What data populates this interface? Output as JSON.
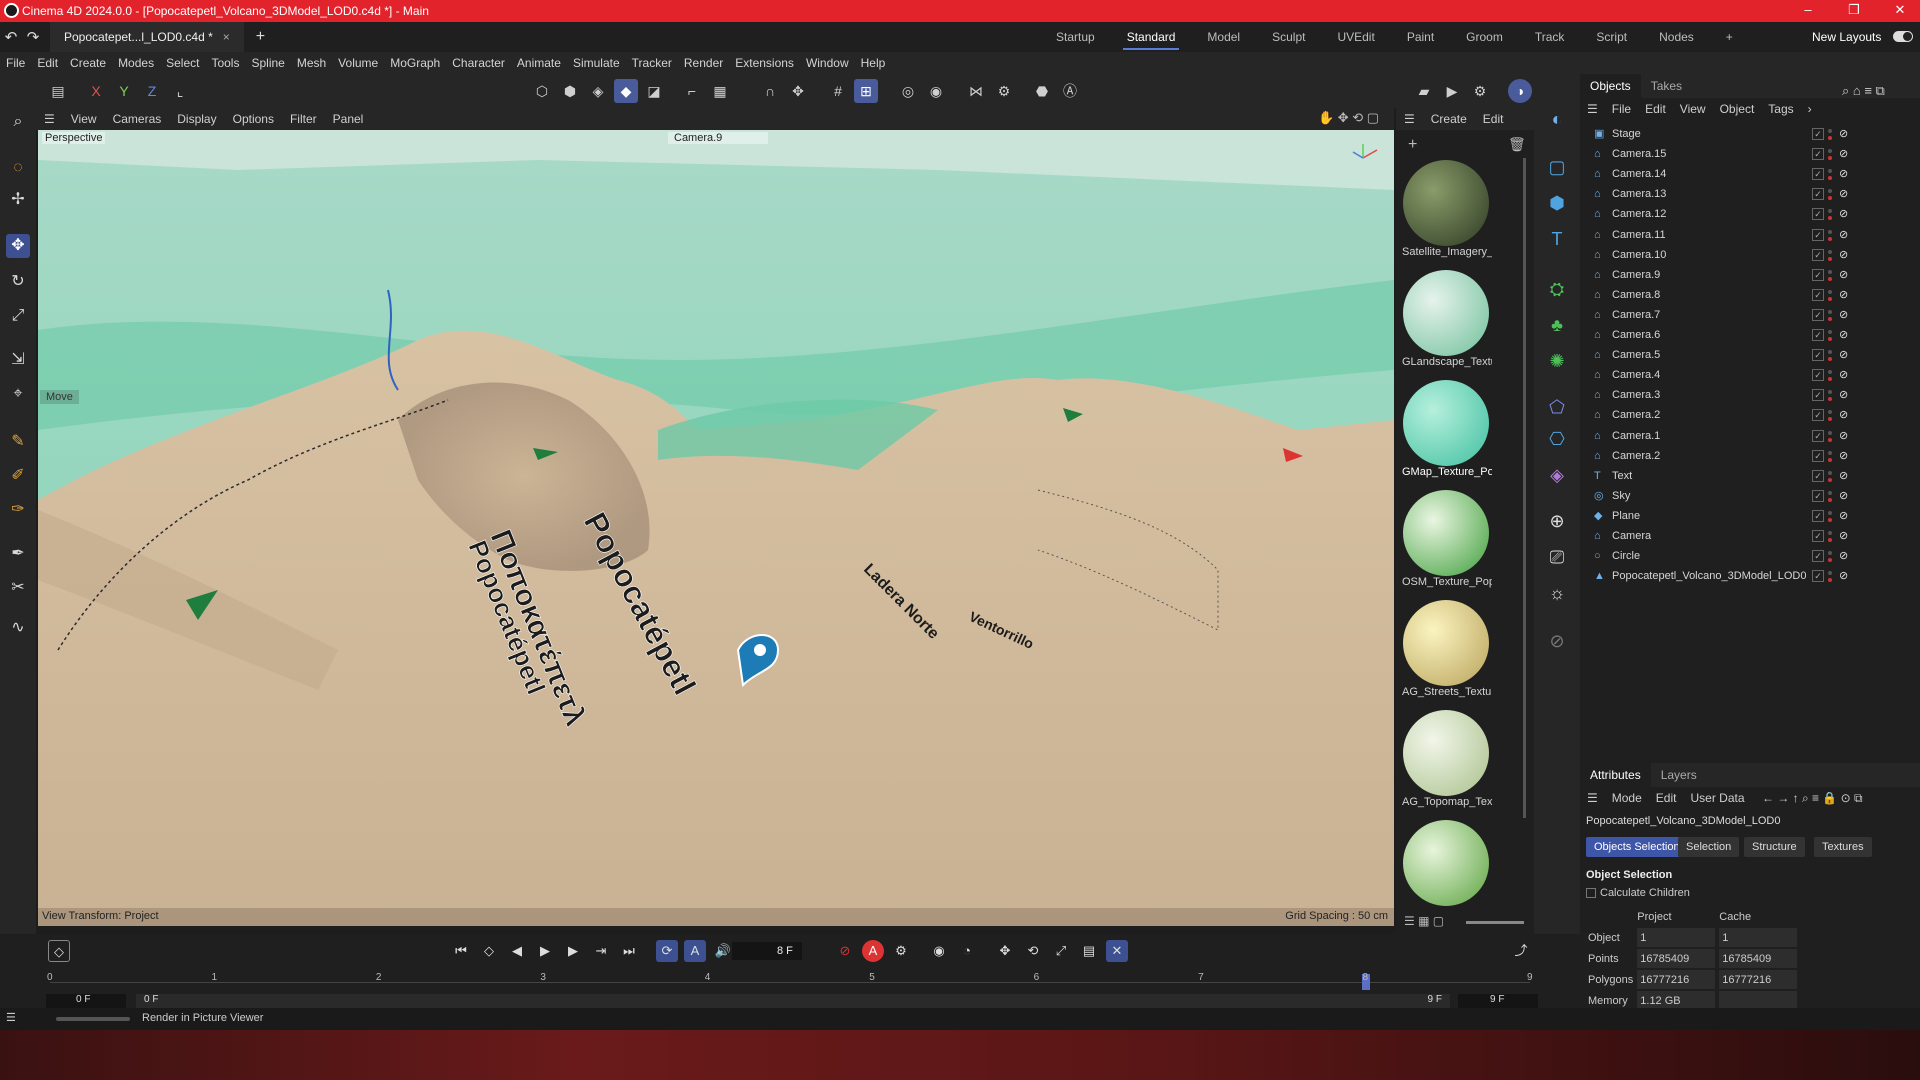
{
  "window": {
    "title": "Cinema 4D 2024.0.0 - [Popocatepetl_Volcano_3DModel_LOD0.c4d *] - Main",
    "minimize": "–",
    "restore": "❐",
    "close": "✕"
  },
  "doc_tab": {
    "label": "Popocatepet...l_LOD0.c4d *",
    "close": "×",
    "add": "+"
  },
  "layouts": {
    "items": [
      "Startup",
      "Standard",
      "Model",
      "Sculpt",
      "UVEdit",
      "Paint",
      "Groom",
      "Track",
      "Script",
      "Nodes"
    ],
    "active": "Standard",
    "add": "+",
    "new_layouts": "New Layouts"
  },
  "menu": [
    "File",
    "Edit",
    "Create",
    "Modes",
    "Select",
    "Tools",
    "Spline",
    "Mesh",
    "Volume",
    "MoGraph",
    "Character",
    "Animate",
    "Simulate",
    "Tracker",
    "Render",
    "Extensions",
    "Window",
    "Help"
  ],
  "axis_toolbar": {
    "x": "X",
    "y": "Y",
    "z": "Z"
  },
  "viewport": {
    "menu": [
      "View",
      "Cameras",
      "Display",
      "Options",
      "Filter",
      "Panel"
    ],
    "view_name": "Perspective",
    "camera": "Camera.9",
    "tool_hint": "Move",
    "view_transform": "View Transform: Project",
    "grid_spacing": "Grid Spacing : 50 cm",
    "map_labels": {
      "main_latin": "Popocatépetl",
      "main_greek": "Ποποκατέπετλ",
      "side_latin": "Popocatépetl",
      "ridge_north": "Ladera Norte",
      "ridge_sw": "Ventorrillo"
    }
  },
  "material_panel": {
    "menu": [
      "Create",
      "Edit"
    ],
    "materials": [
      {
        "name": "Satellite_Imagery_",
        "color1": "#8a9c6a",
        "color2": "#2d3a22"
      },
      {
        "name": "GLandscape_Textu",
        "color1": "#e6f3ec",
        "color2": "#6fbf9a"
      },
      {
        "name": "GMap_Texture_Po",
        "color1": "#b6f0dc",
        "color2": "#3fbfa0"
      },
      {
        "name": "OSM_Texture_Pop",
        "color1": "#eaf6e2",
        "color2": "#3e9e3a"
      },
      {
        "name": "AG_Streets_Textur",
        "color1": "#fbf4c0",
        "color2": "#b8a25a"
      },
      {
        "name": "AG_Topomap_Tex",
        "color1": "#f2f6ea",
        "color2": "#a8c08a"
      },
      {
        "name": "",
        "color1": "#e8f5dc",
        "color2": "#5aa23e"
      }
    ],
    "selected": "GMap_Texture_Po"
  },
  "objects_panel": {
    "tabs": [
      "Objects",
      "Takes"
    ],
    "menu": [
      "File",
      "Edit",
      "View",
      "Object",
      "Tags"
    ],
    "items": [
      {
        "name": "Stage",
        "icon": "▣"
      },
      {
        "name": "Camera.15",
        "icon": "⌂"
      },
      {
        "name": "Camera.14",
        "icon": "⌂"
      },
      {
        "name": "Camera.13",
        "icon": "⌂"
      },
      {
        "name": "Camera.12",
        "icon": "⌂"
      },
      {
        "name": "Camera.11",
        "icon": "⌂"
      },
      {
        "name": "Camera.10",
        "icon": "⌂"
      },
      {
        "name": "Camera.9",
        "icon": "⌂"
      },
      {
        "name": "Camera.8",
        "icon": "⌂"
      },
      {
        "name": "Camera.7",
        "icon": "⌂"
      },
      {
        "name": "Camera.6",
        "icon": "⌂"
      },
      {
        "name": "Camera.5",
        "icon": "⌂"
      },
      {
        "name": "Camera.4",
        "icon": "⌂"
      },
      {
        "name": "Camera.3",
        "icon": "⌂"
      },
      {
        "name": "Camera.2",
        "icon": "⌂"
      },
      {
        "name": "Camera.1",
        "icon": "⌂"
      },
      {
        "name": "Camera.2",
        "icon": "⌂"
      },
      {
        "name": "Text",
        "icon": "T"
      },
      {
        "name": "Sky",
        "icon": "◎"
      },
      {
        "name": "Plane",
        "icon": "◆"
      },
      {
        "name": "Camera",
        "icon": "⌂"
      },
      {
        "name": "Circle",
        "icon": "○"
      },
      {
        "name": "Popocatepetl_Volcano_3DModel_LOD0",
        "icon": "▲"
      }
    ]
  },
  "attributes_panel": {
    "tabs": [
      "Attributes",
      "Layers"
    ],
    "menu": [
      "Mode",
      "Edit",
      "User Data"
    ],
    "object_name": "Popocatepetl_Volcano_3DModel_LOD0",
    "buttons": [
      "Objects Selection",
      "Selection",
      "Structure",
      "Textures"
    ],
    "section": "Object Selection",
    "calculate_children": "Calculate Children",
    "columns": [
      "Project",
      "Cache"
    ],
    "rows": [
      {
        "label": "Object",
        "project": "1",
        "cache": "1"
      },
      {
        "label": "Points",
        "project": "16785409",
        "cache": "16785409"
      },
      {
        "label": "Polygons",
        "project": "16777216",
        "cache": "16777216"
      },
      {
        "label": "Memory",
        "project": "1.12 GB",
        "cache": ""
      }
    ]
  },
  "timeline": {
    "current_frame": "8 F",
    "ticks": [
      "0",
      "1",
      "2",
      "3",
      "4",
      "5",
      "6",
      "7",
      "8",
      "9"
    ],
    "start": "0 F",
    "range_start": "0 F",
    "range_end": "9 F",
    "end": "9 F",
    "playhead_frame": 8,
    "frame_max": 9
  },
  "status": {
    "text": "Render in Picture Viewer"
  }
}
